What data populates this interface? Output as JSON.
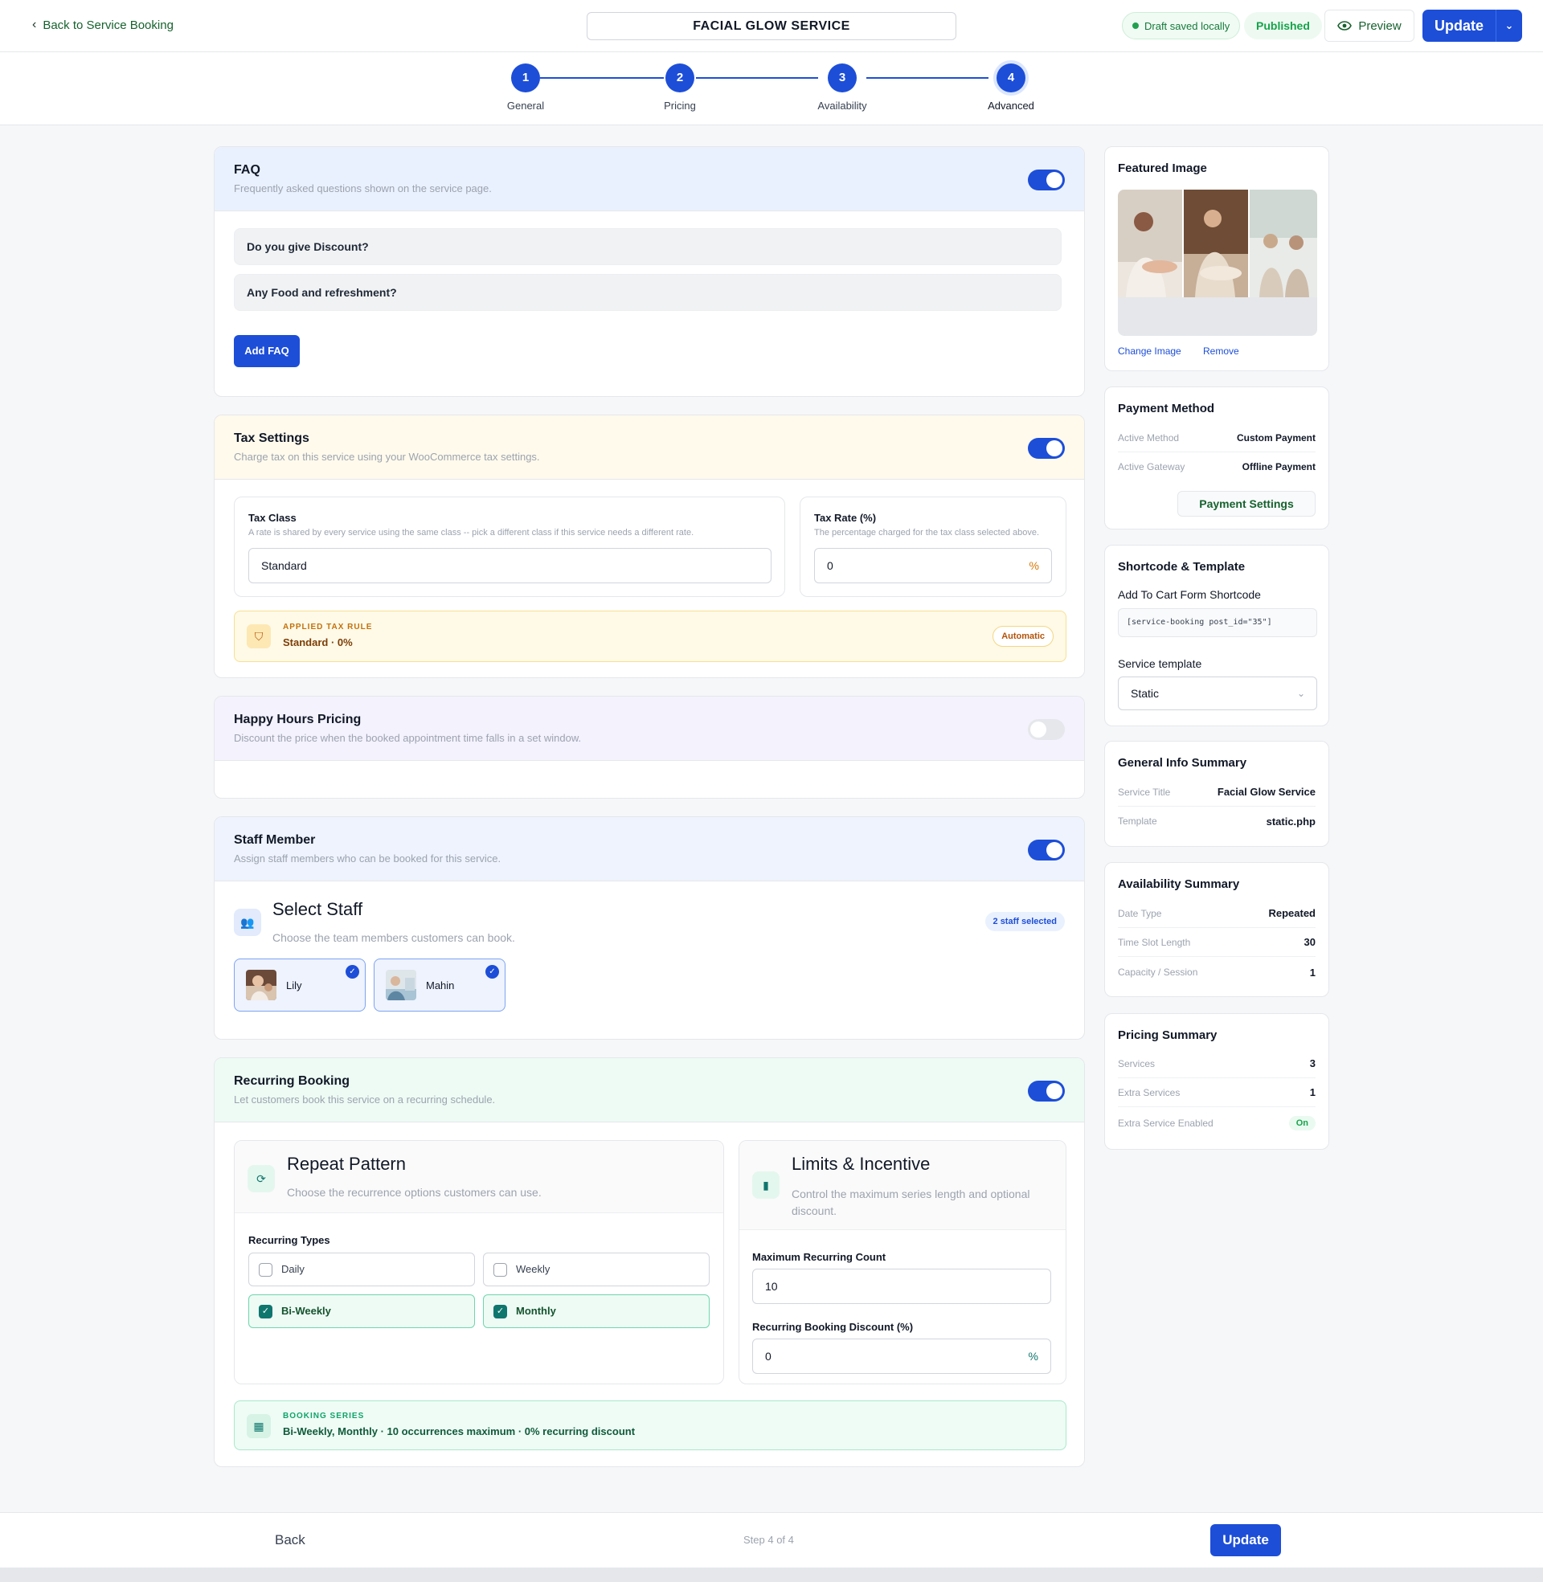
{
  "header": {
    "back_label": "Back to Service Booking",
    "title": "FACIAL GLOW SERVICE",
    "draft_status": "Draft saved locally",
    "publish_status": "Published",
    "preview_label": "Preview",
    "update_label": "Update"
  },
  "steps": [
    {
      "num": "1",
      "label": "General"
    },
    {
      "num": "2",
      "label": "Pricing"
    },
    {
      "num": "3",
      "label": "Availability"
    },
    {
      "num": "4",
      "label": "Advanced"
    }
  ],
  "faq": {
    "title": "FAQ",
    "desc": "Frequently asked questions shown on the service page.",
    "enabled": true,
    "items": [
      "Do you give Discount?",
      "Any Food and refreshment?"
    ],
    "add_label": "Add FAQ"
  },
  "tax": {
    "title": "Tax Settings",
    "desc": "Charge tax on this service using your WooCommerce tax settings.",
    "enabled": true,
    "class_label": "Tax Class",
    "class_hint": "A rate is shared by every service using the same class -- pick a different class if this service needs a different rate.",
    "class_value": "Standard",
    "rate_label": "Tax Rate (%)",
    "rate_hint": "The percentage charged for the tax class selected above.",
    "rate_value": "0",
    "rate_unit": "%",
    "rule_label": "APPLIED TAX RULE",
    "rule_value": "Standard · 0%",
    "rule_badge": "Automatic"
  },
  "happy_hours": {
    "title": "Happy Hours Pricing",
    "desc": "Discount the price when the booked appointment time falls in a set window.",
    "enabled": false
  },
  "staff": {
    "title": "Staff Member",
    "desc": "Assign staff members who can be booked for this service.",
    "enabled": true,
    "select_title": "Select Staff",
    "select_desc": "Choose the team members customers can book.",
    "count_badge": "2 staff selected",
    "members": [
      {
        "name": "Lily",
        "selected": true
      },
      {
        "name": "Mahin",
        "selected": true
      }
    ]
  },
  "recurring": {
    "title": "Recurring Booking",
    "desc": "Let customers book this service on a recurring schedule.",
    "enabled": true,
    "pattern_title": "Repeat Pattern",
    "pattern_desc": "Choose the recurrence options customers can use.",
    "types_label": "Recurring Types",
    "types": [
      {
        "label": "Daily",
        "checked": false
      },
      {
        "label": "Weekly",
        "checked": false
      },
      {
        "label": "Bi-Weekly",
        "checked": true
      },
      {
        "label": "Monthly",
        "checked": true
      }
    ],
    "limits_title": "Limits & Incentive",
    "limits_desc": "Control the maximum series length and optional discount.",
    "max_label": "Maximum Recurring Count",
    "max_value": "10",
    "discount_label": "Recurring Booking Discount (%)",
    "discount_value": "0",
    "discount_unit": "%",
    "series_label": "BOOKING SERIES",
    "series_value": "Bi-Weekly, Monthly · 10 occurrences maximum · 0% recurring discount"
  },
  "sidebar": {
    "featured": {
      "title": "Featured Image",
      "change_label": "Change Image",
      "remove_label": "Remove"
    },
    "payment": {
      "title": "Payment Method",
      "rows": [
        {
          "k": "Active Method",
          "v": "Custom Payment"
        },
        {
          "k": "Active Gateway",
          "v": "Offline Payment"
        }
      ],
      "settings_label": "Payment Settings"
    },
    "shortcode": {
      "title": "Shortcode & Template",
      "cart_label": "Add To Cart Form Shortcode",
      "code": "[service-booking post_id=\"35\"]",
      "template_label": "Service template",
      "template_value": "Static"
    },
    "general": {
      "title": "General Info Summary",
      "rows": [
        {
          "k": "Service Title",
          "v": "Facial Glow Service"
        },
        {
          "k": "Template",
          "v": "static.php"
        }
      ]
    },
    "availability": {
      "title": "Availability Summary",
      "rows": [
        {
          "k": "Date Type",
          "v": "Repeated"
        },
        {
          "k": "Time Slot Length",
          "v": "30"
        },
        {
          "k": "Capacity / Session",
          "v": "1"
        }
      ]
    },
    "pricing": {
      "title": "Pricing Summary",
      "rows": [
        {
          "k": "Services",
          "v": "3"
        },
        {
          "k": "Extra Services",
          "v": "1"
        },
        {
          "k": "Extra Service Enabled",
          "v": "On"
        }
      ]
    }
  },
  "footer": {
    "back_label": "Back",
    "step_text": "Step 4 of 4",
    "update_label": "Update"
  },
  "colors": {
    "primary": "#1d4ed8",
    "success": "#16a34a",
    "teal": "#0f766e",
    "warning": "#d97706"
  }
}
